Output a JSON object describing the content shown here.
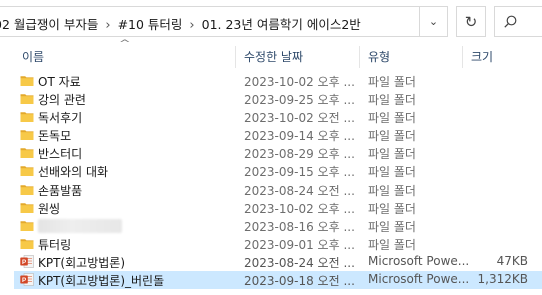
{
  "address": {
    "crumbs": [
      "02 월급쟁이 부자들",
      "#10 튜터링",
      "01. 23년 여름학기 에이스2반"
    ],
    "dropdown_glyph": "⌄",
    "refresh_glyph": "↻",
    "search_placeholder": "ㅇ"
  },
  "columns": {
    "name": "이름",
    "date": "수정한 날짜",
    "type": "유형",
    "size": "크기"
  },
  "rows": [
    {
      "name": "OT 자료",
      "date": "2023-10-02 오후 ...",
      "type": "파일 폴더",
      "size": "",
      "icon": "folder-icon"
    },
    {
      "name": "강의 관련",
      "date": "2023-09-25 오후 ...",
      "type": "파일 폴더",
      "size": "",
      "icon": "folder-icon"
    },
    {
      "name": "독서후기",
      "date": "2023-10-02 오전 ...",
      "type": "파일 폴더",
      "size": "",
      "icon": "folder-icon"
    },
    {
      "name": "돈독모",
      "date": "2023-09-14 오후 ...",
      "type": "파일 폴더",
      "size": "",
      "icon": "folder-icon"
    },
    {
      "name": "반스터디",
      "date": "2023-08-29 오후 ...",
      "type": "파일 폴더",
      "size": "",
      "icon": "folder-icon"
    },
    {
      "name": "선배와의 대화",
      "date": "2023-09-15 오후 ...",
      "type": "파일 폴더",
      "size": "",
      "icon": "folder-icon"
    },
    {
      "name": "손품발품",
      "date": "2023-08-24 오전 ...",
      "type": "파일 폴더",
      "size": "",
      "icon": "folder-icon"
    },
    {
      "name": "원씽",
      "date": "2023-10-02 오후 ...",
      "type": "파일 폴더",
      "size": "",
      "icon": "folder-icon"
    },
    {
      "name": "",
      "date": "2023-08-16 오후 ...",
      "type": "파일 폴더",
      "size": "",
      "icon": "folder-icon",
      "blurred": true
    },
    {
      "name": "튜터링",
      "date": "2023-09-01 오후 ...",
      "type": "파일 폴더",
      "size": "",
      "icon": "folder-icon"
    },
    {
      "name": "KPT(회고방법론)",
      "date": "2023-08-24 오전 ...",
      "type": "Microsoft Powe...",
      "size": "47KB",
      "icon": "powerpoint-icon"
    },
    {
      "name": "KPT(회고방법론)_버린돌",
      "date": "2023-09-18 오전 ...",
      "type": "Microsoft Powe...",
      "size": "1,312KB",
      "icon": "powerpoint-icon",
      "selected": true
    }
  ],
  "colors": {
    "folder": "#f7c948",
    "folder_dark": "#e3a92b",
    "ppt": "#d24726",
    "selection": "#cce8ff",
    "header_text": "#2f4a6b"
  }
}
